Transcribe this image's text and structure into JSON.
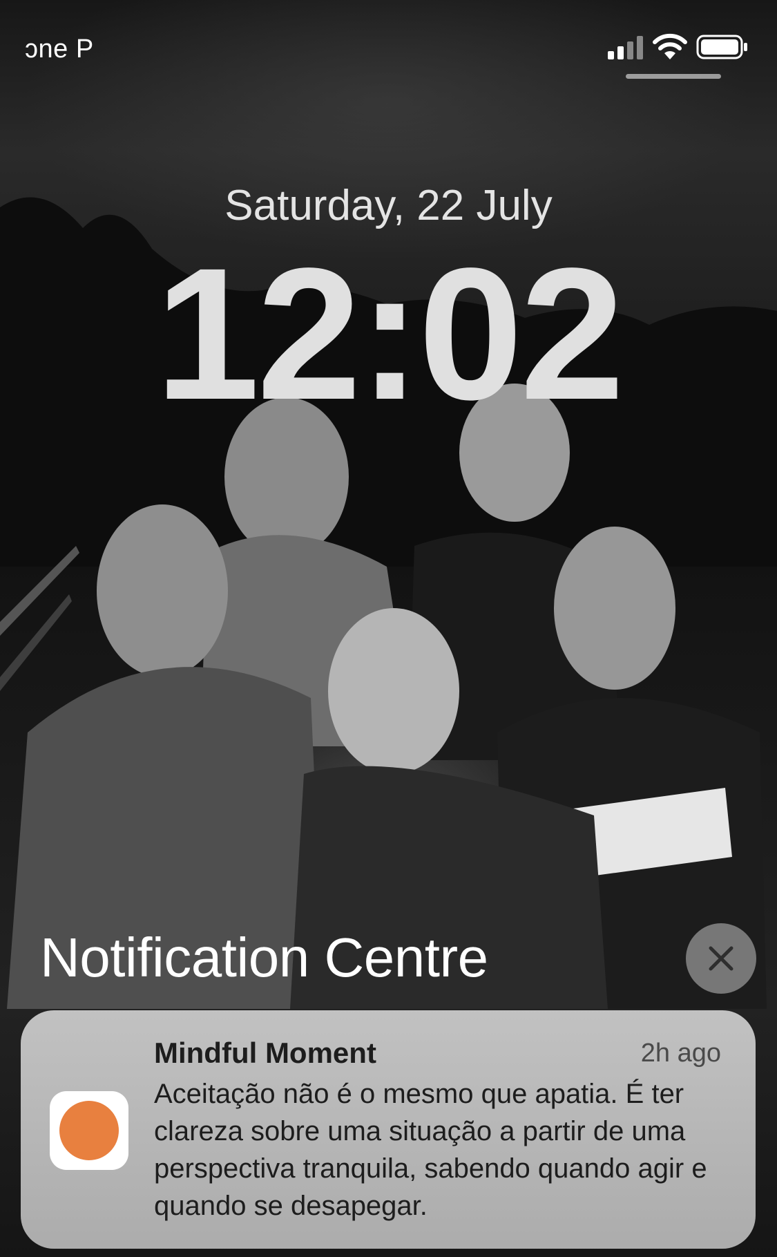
{
  "status_bar": {
    "carrier": "ɔne P",
    "signal_icon": "cellular-signal-icon",
    "wifi_icon": "wifi-icon",
    "battery_icon": "battery-full-icon"
  },
  "lock_screen": {
    "date": "Saturday, 22 July",
    "time": "12:02"
  },
  "notification_centre": {
    "title": "Notification Centre",
    "close_icon": "close-icon"
  },
  "notification": {
    "app_name": "Mindful Moment",
    "time_ago": "2h ago",
    "message": "Aceitação não é o mesmo que apatia. É ter clareza sobre uma situação a partir de uma perspectiva tranquila, sabendo quando agir e quando se desapegar.",
    "app_icon_color": "#e8803f"
  }
}
